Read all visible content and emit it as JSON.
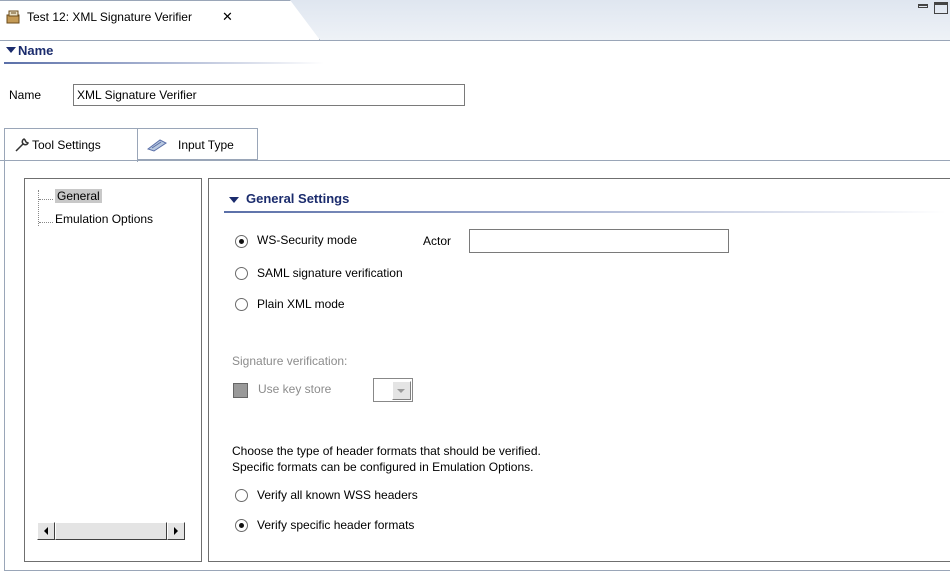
{
  "editor": {
    "tab_title": "Test 12: XML Signature Verifier",
    "tab_icon": "tool-icon",
    "close_glyph": "✕"
  },
  "name_section": {
    "header": "Name",
    "label": "Name",
    "value": "XML Signature Verifier"
  },
  "tabs": [
    {
      "label": "Tool Settings",
      "icon": "wrench-icon",
      "selected": true
    },
    {
      "label": "Input Type",
      "icon": "input-type-icon",
      "selected": false
    }
  ],
  "tree": {
    "items": [
      {
        "label": "General",
        "selected": true
      },
      {
        "label": "Emulation Options",
        "selected": false
      }
    ]
  },
  "general_settings": {
    "header": "General Settings",
    "modes": [
      {
        "label": "WS-Security mode",
        "selected": true
      },
      {
        "label": "SAML signature verification",
        "selected": false
      },
      {
        "label": "Plain XML mode",
        "selected": false
      }
    ],
    "actor_label": "Actor",
    "actor_value": "",
    "signature_verification_label": "Signature verification:",
    "use_key_store_label": "Use key store",
    "help_line1": "Choose the type of header formats that should be verified.",
    "help_line2": "Specific formats can be configured in Emulation Options.",
    "header_options": [
      {
        "label": "Verify all known WSS headers",
        "selected": false
      },
      {
        "label": "Verify specific header formats",
        "selected": true
      }
    ]
  },
  "colors": {
    "section_header": "#1b2c6d",
    "border": "#9aa6b8",
    "disabled_text": "#8c8c8c"
  }
}
